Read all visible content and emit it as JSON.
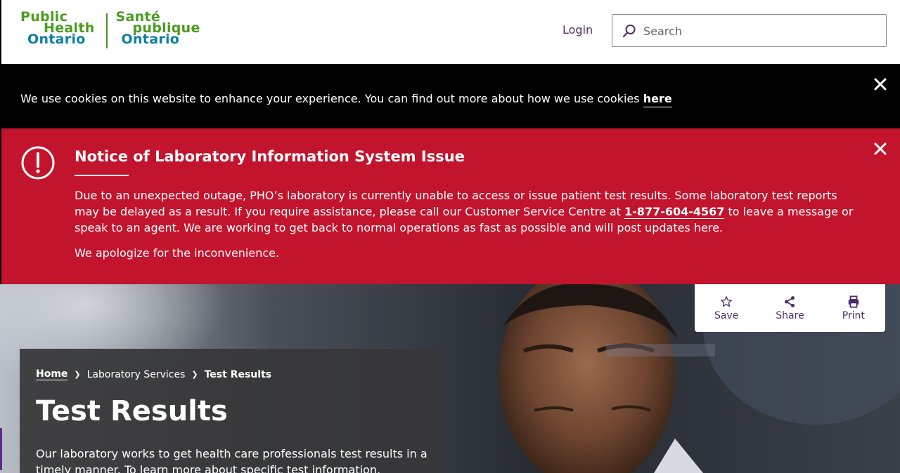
{
  "header": {
    "logo": {
      "en": [
        "Public",
        "Health",
        "Ontario"
      ],
      "fr": [
        "Santé",
        "publique",
        "Ontario"
      ]
    },
    "login_label": "Login",
    "search_placeholder": "Search"
  },
  "cookie_banner": {
    "text": "We use cookies on this website to enhance your experience. You can find out more about how we use cookies ",
    "link_label": "here"
  },
  "alert": {
    "title": "Notice of Laboratory Information System Issue",
    "body_before_phone": "Due to an unexpected outage, PHO’s laboratory is currently unable to access or issue patient test results. Some laboratory test reports may be delayed as a result. If you require assistance, please call our Customer Service Centre at ",
    "phone": "1-877-604-4567",
    "body_after_phone": " to leave a message or speak to an agent. We are working to get back to normal operations as fast as possible and will post updates here.",
    "apology": "We apologize for the inconvenience."
  },
  "tools": {
    "save_label": "Save",
    "share_label": "Share",
    "print_label": "Print"
  },
  "hero": {
    "breadcrumb": {
      "home": "Home",
      "middle": "Laboratory Services",
      "current": "Test Results"
    },
    "title": "Test Results",
    "description": "Our laboratory works to get health care professionals test results in a timely manner. To learn more about specific test information, including submitting"
  },
  "colors": {
    "alert_red": "#c3142d",
    "brand_purple": "#4b2e6d",
    "logo_green": "#4a9a1e",
    "logo_blue": "#0d7fa4"
  }
}
